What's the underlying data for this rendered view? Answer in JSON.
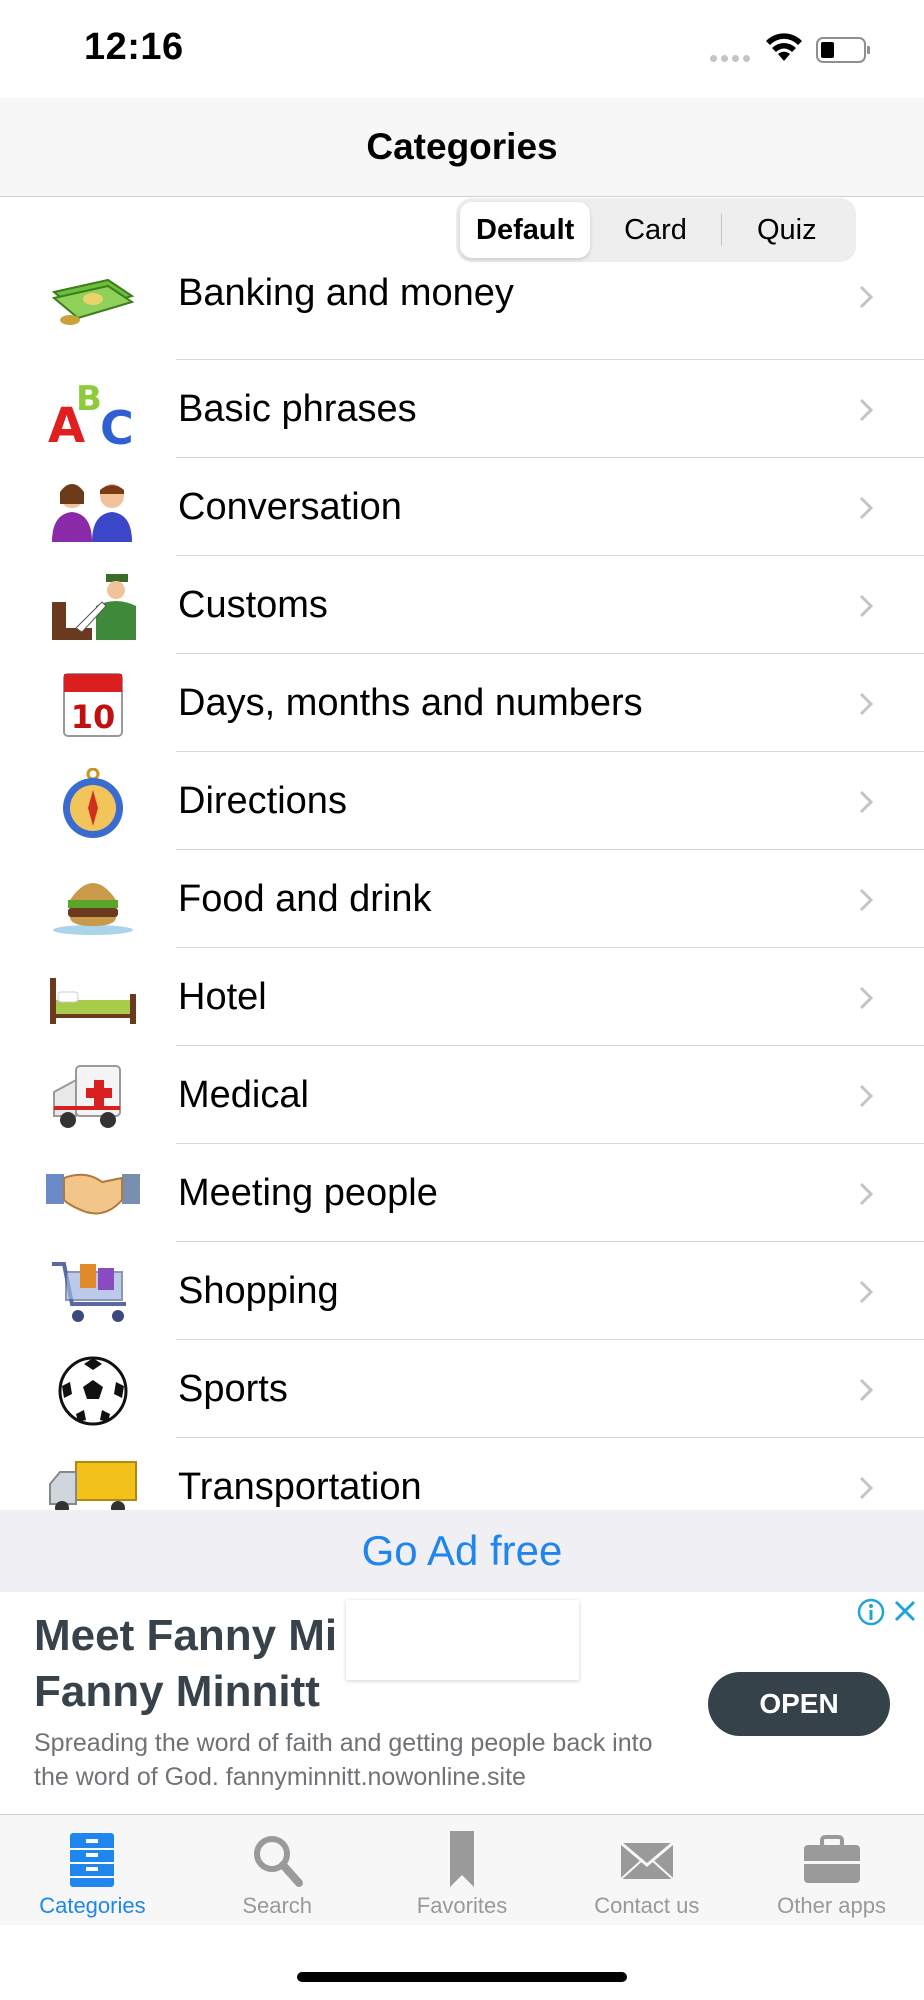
{
  "status_bar": {
    "time": "12:16"
  },
  "nav": {
    "title": "Categories"
  },
  "segment": {
    "options": [
      "Default",
      "Card",
      "Quiz"
    ],
    "selected": "Default"
  },
  "categories": [
    {
      "label": "Banking and money",
      "icon": "money-icon"
    },
    {
      "label": "Basic phrases",
      "icon": "abc-icon"
    },
    {
      "label": "Conversation",
      "icon": "people-talking-icon"
    },
    {
      "label": "Customs",
      "icon": "customs-officer-icon"
    },
    {
      "label": "Days, months and numbers",
      "icon": "calendar-icon"
    },
    {
      "label": "Directions",
      "icon": "compass-icon"
    },
    {
      "label": "Food and drink",
      "icon": "burger-icon"
    },
    {
      "label": "Hotel",
      "icon": "bed-icon"
    },
    {
      "label": "Medical",
      "icon": "ambulance-icon"
    },
    {
      "label": "Meeting people",
      "icon": "handshake-icon"
    },
    {
      "label": "Shopping",
      "icon": "shopping-cart-icon"
    },
    {
      "label": "Sports",
      "icon": "soccer-ball-icon"
    },
    {
      "label": "Transportation",
      "icon": "truck-icon"
    }
  ],
  "ad_free": {
    "label": "Go Ad free"
  },
  "ad": {
    "headline": "Meet Fanny Minnitt Fanny Minnitt",
    "headline_line1": "Meet Fanny Mi",
    "headline_line2": "Fanny Minnitt",
    "body": "Spreading the word of faith and getting people back into the word of God. fannyminnitt.nowonline.site",
    "button": "OPEN"
  },
  "tabs": [
    {
      "label": "Categories",
      "icon": "categories-icon",
      "active": true
    },
    {
      "label": "Search",
      "icon": "search-icon",
      "active": false
    },
    {
      "label": "Favorites",
      "icon": "bookmark-icon",
      "active": false
    },
    {
      "label": "Contact us",
      "icon": "envelope-icon",
      "active": false
    },
    {
      "label": "Other apps",
      "icon": "briefcase-icon",
      "active": false
    }
  ],
  "colors": {
    "accent": "#1f86ee",
    "ad_button": "#36424a"
  }
}
